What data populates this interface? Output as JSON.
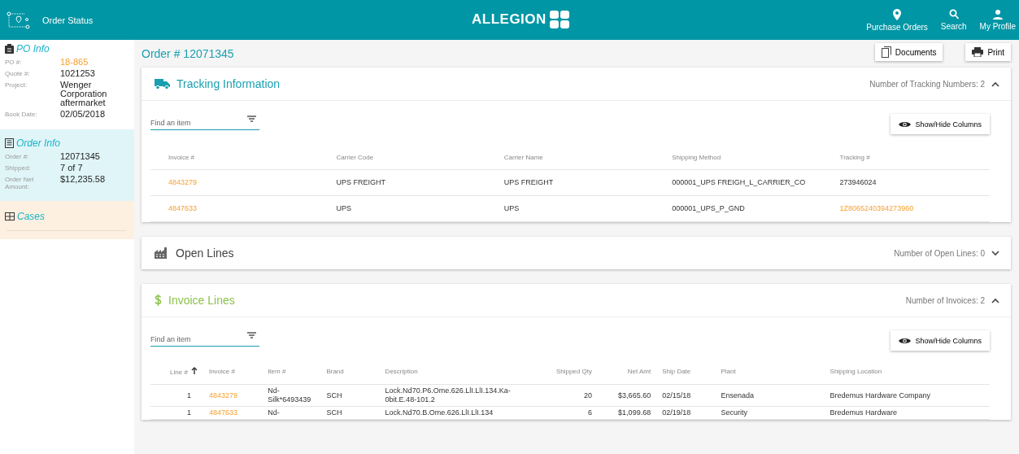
{
  "header": {
    "app_title": "Order Status",
    "brand": "ALLEGION",
    "nav": [
      {
        "kind": "pin",
        "label": "Purchase Orders"
      },
      {
        "kind": "search",
        "label": "Search"
      },
      {
        "kind": "person",
        "label": "My Profile"
      }
    ]
  },
  "sidebar": [
    {
      "kind": "po",
      "title": "PO Info",
      "fields": [
        {
          "label": "PO #:",
          "value": "18-865",
          "link": true
        },
        {
          "label": "Quote #:",
          "value": "1021253",
          "link": false
        },
        {
          "label": "Project:",
          "value": "Wenger Corporation aftermarket",
          "link": false
        },
        {
          "label": "Book Date:",
          "value": "02/05/2018",
          "link": false
        }
      ]
    },
    {
      "kind": "order",
      "title": "Order Info",
      "fields": [
        {
          "label": "Order #:",
          "value": "12071345",
          "link": false
        },
        {
          "label": "Shipped:",
          "value": "7 of 7",
          "link": false
        },
        {
          "label": "Order Net Amount:",
          "value": "$12,235.58",
          "link": false
        }
      ]
    },
    {
      "kind": "cases",
      "title": "Cases"
    }
  ],
  "order_title": "Order # 12071345",
  "actions": [
    {
      "kind": "documents",
      "label": "Documents"
    },
    {
      "kind": "print",
      "label": "Print"
    }
  ],
  "panels": [
    {
      "kind": "tracking",
      "title": "Tracking Information",
      "summary": "Number of Tracking Numbers: 2",
      "expanded": true,
      "search": {
        "placeholder": "Find an item"
      },
      "columns_button": "Show/Hide Columns",
      "columns": [
        {
          "label": "Invoice #",
          "numeric": false,
          "sorted": false
        },
        {
          "label": "Carrier Code",
          "numeric": false,
          "sorted": false
        },
        {
          "label": "Carrier Name",
          "numeric": false,
          "sorted": false
        },
        {
          "label": "Shipping Method",
          "numeric": false,
          "sorted": false
        },
        {
          "label": "Tracking #",
          "numeric": false,
          "sorted": false
        }
      ],
      "rows": [
        [
          {
            "text": "4843279",
            "link": true
          },
          {
            "text": "UPS FREIGHT",
            "link": false
          },
          {
            "text": "UPS FREIGHT",
            "link": false
          },
          {
            "text": "000001_UPS FREIGH_L_CARRIER_CO",
            "link": false
          },
          {
            "text": "273946024",
            "link": false
          }
        ],
        [
          {
            "text": "4847633",
            "link": true
          },
          {
            "text": "UPS",
            "link": false
          },
          {
            "text": "UPS",
            "link": false
          },
          {
            "text": "000001_UPS_P_GND",
            "link": false
          },
          {
            "text": "1Z8065240394273960",
            "link": true
          }
        ]
      ]
    },
    {
      "kind": "open",
      "title": "Open Lines",
      "summary": "Number of Open Lines: 0",
      "expanded": false
    },
    {
      "kind": "invoice",
      "title": "Invoice Lines",
      "summary": "Number of Invoices: 2",
      "expanded": true,
      "search": {
        "placeholder": "Find an item"
      },
      "columns_button": "Show/Hide Columns",
      "columns": [
        {
          "label": "Line #",
          "numeric": true,
          "sorted": true
        },
        {
          "label": "Invoice #",
          "numeric": false,
          "sorted": false
        },
        {
          "label": "Item #",
          "numeric": false,
          "sorted": false
        },
        {
          "label": "Brand",
          "numeric": false,
          "sorted": false
        },
        {
          "label": "Description",
          "numeric": false,
          "sorted": false
        },
        {
          "label": "Shipped Qty",
          "numeric": true,
          "sorted": false
        },
        {
          "label": "Net Amt",
          "numeric": true,
          "sorted": false
        },
        {
          "label": "Ship Date",
          "numeric": false,
          "sorted": false
        },
        {
          "label": "Plant",
          "numeric": false,
          "sorted": false
        },
        {
          "label": "Shipping Location",
          "numeric": false,
          "sorted": false
        }
      ],
      "rows": [
        [
          {
            "text": "1",
            "link": false
          },
          {
            "text": "4843279",
            "link": true
          },
          {
            "text": "Nd-Silk*6493439",
            "link": false
          },
          {
            "text": "SCH",
            "link": false
          },
          {
            "text": "Lock.Nd70.P6.Ome.626.LlI.LlI.134.Ka-0bit.E.48-101.2",
            "link": false
          },
          {
            "text": "20",
            "link": false
          },
          {
            "text": "$3,665.60",
            "link": false
          },
          {
            "text": "02/15/18",
            "link": false
          },
          {
            "text": "Ensenada",
            "link": false
          },
          {
            "text": "Bredemus Hardware Company",
            "link": false
          }
        ],
        [
          {
            "text": "1",
            "link": false
          },
          {
            "text": "4847633",
            "link": true
          },
          {
            "text": "Nd-",
            "link": false
          },
          {
            "text": "SCH",
            "link": false
          },
          {
            "text": "Lock.Nd70.B.Ome.626.LlI.LlI.134",
            "link": false
          },
          {
            "text": "6",
            "link": false
          },
          {
            "text": "$1,099.68",
            "link": false
          },
          {
            "text": "02/19/18",
            "link": false
          },
          {
            "text": "Security",
            "link": false
          },
          {
            "text": "Bredemus Hardware",
            "link": false
          }
        ]
      ]
    }
  ]
}
